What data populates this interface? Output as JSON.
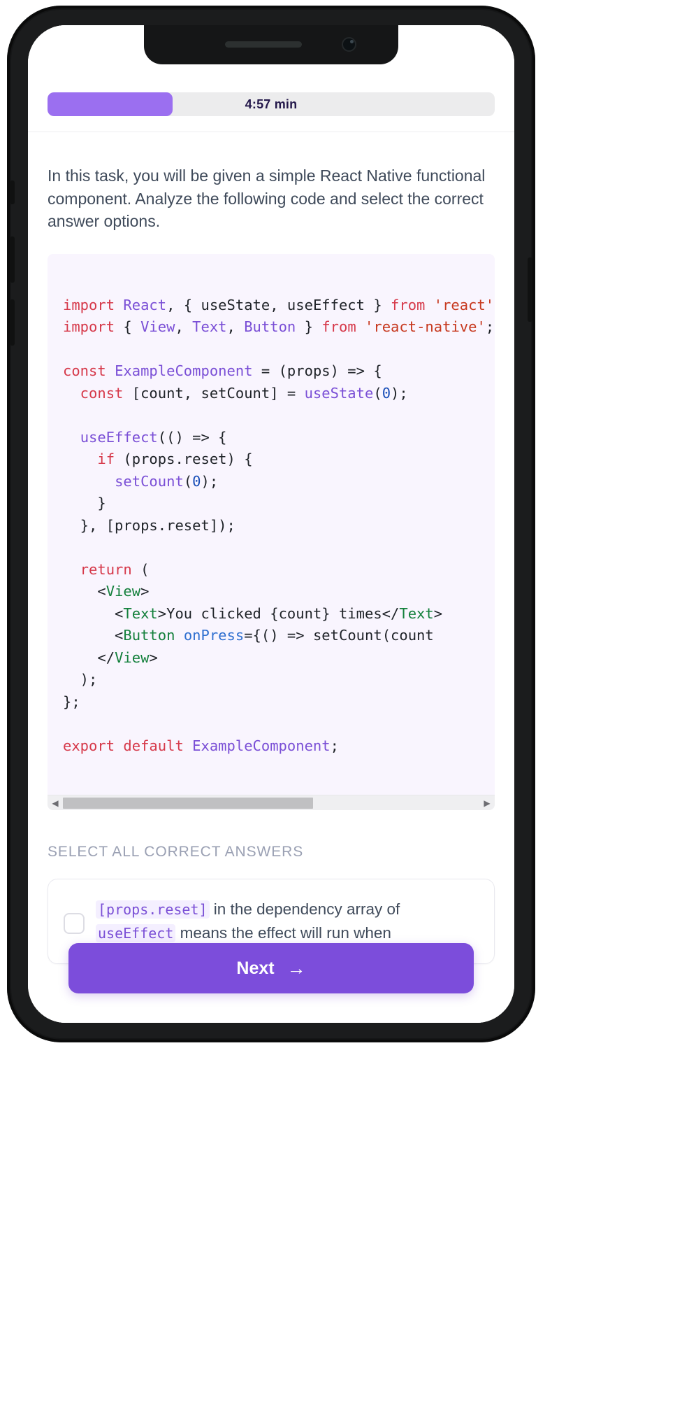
{
  "device": {
    "notch": {
      "speaker_icon": "speaker-grille-icon",
      "camera_icon": "front-camera-icon"
    },
    "buttons": {
      "silent": "silent-switch",
      "volume_up": "volume-up-button",
      "volume_down": "volume-down-button",
      "power": "power-button"
    }
  },
  "header": {
    "progress_label": "4:57 min",
    "progress_percent": 28,
    "fill_color": "#9b6ff0",
    "track_color": "#ececed"
  },
  "main": {
    "instructions": "In this task, you will be given a simple React Native functional component. Analyze the following code and select the correct answer options.",
    "code_block": {
      "language": "jsx",
      "background": "#f9f5fe",
      "lines": [
        [
          {
            "t": "import ",
            "c": "kw"
          },
          {
            "t": "React",
            "c": "id"
          },
          {
            "t": ", { useState, useEffect } ",
            "c": "plain"
          },
          {
            "t": "from ",
            "c": "kw"
          },
          {
            "t": "'react'",
            "c": "str"
          },
          {
            "t": ";",
            "c": "plain"
          }
        ],
        [
          {
            "t": "import ",
            "c": "kw"
          },
          {
            "t": "{ ",
            "c": "plain"
          },
          {
            "t": "View",
            "c": "id"
          },
          {
            "t": ", ",
            "c": "plain"
          },
          {
            "t": "Text",
            "c": "id"
          },
          {
            "t": ", ",
            "c": "plain"
          },
          {
            "t": "Button",
            "c": "id"
          },
          {
            "t": " } ",
            "c": "plain"
          },
          {
            "t": "from ",
            "c": "kw"
          },
          {
            "t": "'react-native'",
            "c": "str"
          },
          {
            "t": ";",
            "c": "plain"
          }
        ],
        [],
        [
          {
            "t": "const ",
            "c": "kw"
          },
          {
            "t": "ExampleComponent ",
            "c": "id"
          },
          {
            "t": "= (props) => {",
            "c": "plain"
          }
        ],
        [
          {
            "t": "  const ",
            "c": "kw"
          },
          {
            "t": "[count, setCount] = ",
            "c": "plain"
          },
          {
            "t": "useState",
            "c": "id"
          },
          {
            "t": "(",
            "c": "plain"
          },
          {
            "t": "0",
            "c": "num"
          },
          {
            "t": ");",
            "c": "plain"
          }
        ],
        [],
        [
          {
            "t": "  ",
            "c": "plain"
          },
          {
            "t": "useEffect",
            "c": "id"
          },
          {
            "t": "(() => {",
            "c": "plain"
          }
        ],
        [
          {
            "t": "    if ",
            "c": "kw"
          },
          {
            "t": "(props.reset) {",
            "c": "plain"
          }
        ],
        [
          {
            "t": "      ",
            "c": "plain"
          },
          {
            "t": "setCount",
            "c": "id"
          },
          {
            "t": "(",
            "c": "plain"
          },
          {
            "t": "0",
            "c": "num"
          },
          {
            "t": ");",
            "c": "plain"
          }
        ],
        [
          {
            "t": "    }",
            "c": "plain"
          }
        ],
        [
          {
            "t": "  }, [props.reset]);",
            "c": "plain"
          }
        ],
        [],
        [
          {
            "t": "  return ",
            "c": "kw"
          },
          {
            "t": "(",
            "c": "plain"
          }
        ],
        [
          {
            "t": "    <",
            "c": "plain"
          },
          {
            "t": "View",
            "c": "tag"
          },
          {
            "t": ">",
            "c": "plain"
          }
        ],
        [
          {
            "t": "      <",
            "c": "plain"
          },
          {
            "t": "Text",
            "c": "tag"
          },
          {
            "t": ">You clicked {count} times</",
            "c": "plain"
          },
          {
            "t": "Text",
            "c": "tag"
          },
          {
            "t": ">",
            "c": "plain"
          }
        ],
        [
          {
            "t": "      <",
            "c": "plain"
          },
          {
            "t": "Button",
            "c": "tag"
          },
          {
            "t": " ",
            "c": "plain"
          },
          {
            "t": "onPress",
            "c": "attr"
          },
          {
            "t": "={() => setCount(count",
            "c": "plain"
          }
        ],
        [
          {
            "t": "    </",
            "c": "plain"
          },
          {
            "t": "View",
            "c": "tag"
          },
          {
            "t": ">",
            "c": "plain"
          }
        ],
        [
          {
            "t": "  );",
            "c": "plain"
          }
        ],
        [
          {
            "t": "};",
            "c": "plain"
          }
        ],
        [],
        [
          {
            "t": "export default ",
            "c": "kw"
          },
          {
            "t": "ExampleComponent",
            "c": "id"
          },
          {
            "t": ";",
            "c": "plain"
          }
        ]
      ],
      "scrollbar": {
        "left_arrow_icon": "scroll-left-arrow-icon",
        "right_arrow_icon": "scroll-right-arrow-icon",
        "thumb_percent": 60
      }
    },
    "answers_label": "SELECT ALL CORRECT ANSWERS",
    "options": [
      {
        "checked": false,
        "parts": [
          {
            "t": "[props.reset]",
            "code": true
          },
          {
            "t": " in the dependency array of ",
            "code": false
          },
          {
            "t": "useEffect",
            "code": true
          },
          {
            "t": " means the effect will run when ",
            "code": false
          }
        ]
      }
    ]
  },
  "footer": {
    "next_label": "Next",
    "next_arrow": "→",
    "next_color": "#7c4ddb"
  }
}
